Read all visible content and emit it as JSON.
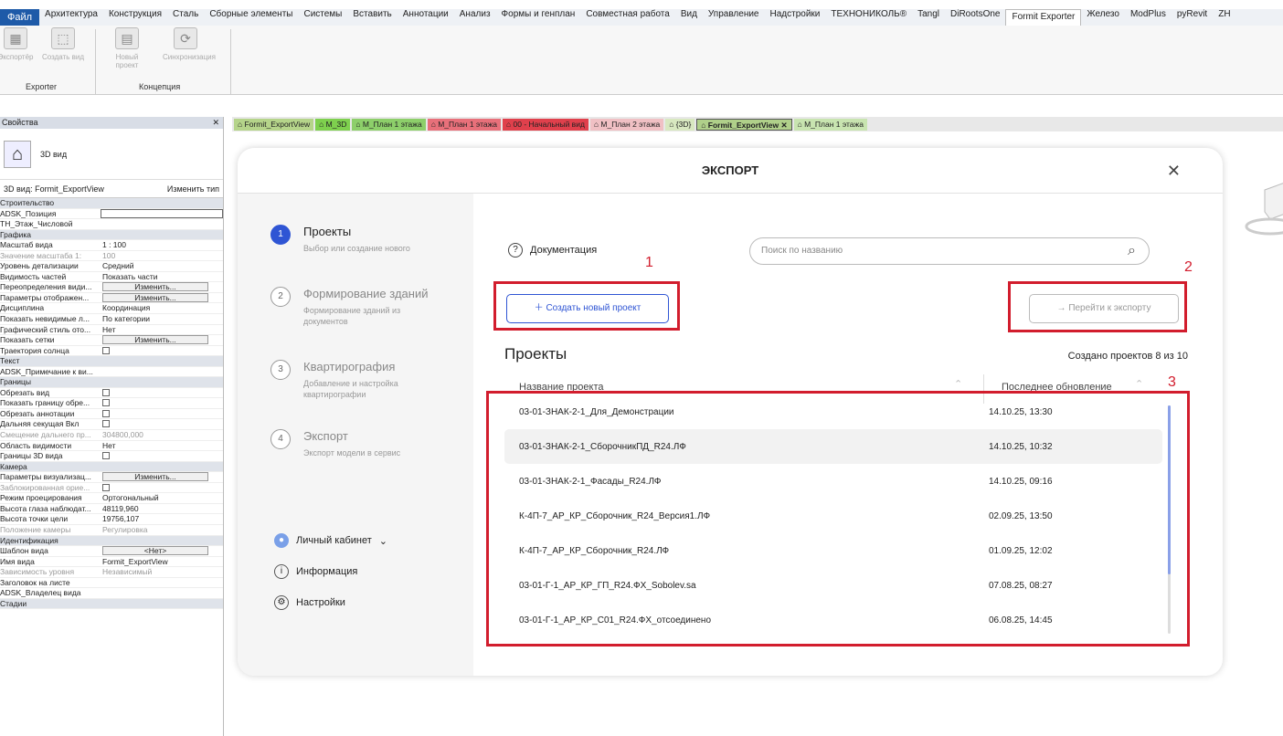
{
  "menu": {
    "file": "Файл",
    "items": [
      "Архитектура",
      "Конструкция",
      "Сталь",
      "Сборные элементы",
      "Системы",
      "Вставить",
      "Аннотации",
      "Анализ",
      "Формы и генплан",
      "Совместная работа",
      "Вид",
      "Управление",
      "Надстройки",
      "ТЕХНОНИКОЛЬ®",
      "Tangl",
      "DiRootsOne",
      "Formit Exporter",
      "Железо",
      "ModPlus",
      "pyRevit",
      "ZH"
    ],
    "active": "Formit Exporter"
  },
  "ribbon": {
    "buttons": [
      "Экспортёр",
      "Создать вид",
      "Новый проект",
      "Синхронизация"
    ],
    "panels": [
      "Exporter",
      "Концепция"
    ]
  },
  "props": {
    "title": "Свойства",
    "type": "3D вид",
    "view_label": "3D вид: Formit_ExportView",
    "edit_type": "Изменить тип",
    "rows": [
      {
        "g": "Строительство"
      },
      {
        "n": "ADSK_Позиция",
        "v": "",
        "input": true
      },
      {
        "n": "ТН_Этаж_Числовой",
        "v": ""
      },
      {
        "g": "Графика"
      },
      {
        "n": "Масштаб вида",
        "v": "1 : 100"
      },
      {
        "n": "Значение масштаба  1:",
        "v": "100",
        "dim": true
      },
      {
        "n": "Уровень детализации",
        "v": "Средний"
      },
      {
        "n": "Видимость частей",
        "v": "Показать части"
      },
      {
        "n": "Переопределения види...",
        "v": "Изменить...",
        "btn": true
      },
      {
        "n": "Параметры отображен...",
        "v": "Изменить...",
        "btn": true
      },
      {
        "n": "Дисциплина",
        "v": "Координация"
      },
      {
        "n": "Показать невидимые л...",
        "v": "По категории"
      },
      {
        "n": "Графический стиль ото...",
        "v": "Нет"
      },
      {
        "n": "Показать сетки",
        "v": "Изменить...",
        "btn": true
      },
      {
        "n": "Траектория солнца",
        "v": "",
        "cb": true
      },
      {
        "g": "Текст"
      },
      {
        "n": "ADSK_Примечание к ви...",
        "v": ""
      },
      {
        "g": "Границы"
      },
      {
        "n": "Обрезать вид",
        "v": "",
        "cb": true
      },
      {
        "n": "Показать границу обре...",
        "v": "",
        "cb": true
      },
      {
        "n": "Обрезать аннотации",
        "v": "",
        "cb": true
      },
      {
        "n": "Дальняя секущая Вкл",
        "v": "",
        "cb": true
      },
      {
        "n": "Смещение дальнего пр...",
        "v": "304800,000",
        "dim": true
      },
      {
        "n": "Область видимости",
        "v": "Нет"
      },
      {
        "n": "Границы 3D вида",
        "v": "",
        "cb": true
      },
      {
        "g": "Камера"
      },
      {
        "n": "Параметры визуализац...",
        "v": "Изменить...",
        "btn": true
      },
      {
        "n": "Заблокированная орие...",
        "v": "",
        "cb": true,
        "dim": true
      },
      {
        "n": "Режим проецирования",
        "v": "Ортогональный"
      },
      {
        "n": "Высота глаза наблюдат...",
        "v": "48119,960"
      },
      {
        "n": "Высота точки цели",
        "v": "19756,107"
      },
      {
        "n": "Положение камеры",
        "v": "Регулировка",
        "dim": true
      },
      {
        "g": "Идентификация"
      },
      {
        "n": "Шаблон вида",
        "v": "<Нет>",
        "btn": true
      },
      {
        "n": "Имя вида",
        "v": "Formit_ExportView"
      },
      {
        "n": "Зависимость уровня",
        "v": "Независимый",
        "dim": true
      },
      {
        "n": "Заголовок на листе",
        "v": ""
      },
      {
        "n": "ADSK_Владелец вида",
        "v": ""
      },
      {
        "g": "Стадии"
      }
    ]
  },
  "tabs": [
    {
      "label": "Formit_ExportView",
      "color": "#b5d48a"
    },
    {
      "label": "M_3D",
      "color": "#7ed04e"
    },
    {
      "label": "M_План 1 этажа",
      "color": "#8dcf6a"
    },
    {
      "label": "M_План 1 этажа",
      "color": "#e8707a"
    },
    {
      "label": "00 - Начальный вид",
      "color": "#e0404c"
    },
    {
      "label": "M_План 2 этажа",
      "color": "#f0c0c4"
    },
    {
      "label": "{3D}",
      "color": "#d8e8c0"
    },
    {
      "label": "Formit_ExportView",
      "color": "#b0d08a",
      "sel": true
    },
    {
      "label": "M_План 1 этажа",
      "color": "#c8e4b0"
    }
  ],
  "dialog": {
    "title": "ЭКСПОРТ",
    "close": "✕",
    "steps": [
      {
        "n": "1",
        "t": "Проекты",
        "s": "Выбор или создание нового",
        "on": true
      },
      {
        "n": "2",
        "t": "Формирование зданий",
        "s": "Формирование зданий из документов"
      },
      {
        "n": "3",
        "t": "Квартирография",
        "s": "Добавление и настройка квартирографии"
      },
      {
        "n": "4",
        "t": "Экспорт",
        "s": "Экспорт модели в сервис"
      }
    ],
    "side": {
      "account": "Личный кабинет",
      "info": "Информация",
      "settings": "Настройки"
    },
    "doc": "Документация",
    "search_placeholder": "Поиск по названию",
    "new_project": "Создать новый проект",
    "go_export": "Перейти к экспорту",
    "projects_title": "Проекты",
    "projects_count": "Создано проектов 8 из 10",
    "col_name": "Название проекта",
    "col_updated": "Последнее обновление",
    "projects": [
      {
        "name": "03-01-ЗНАК-2-1_Для_Демонстрации",
        "date": "14.10.25, 13:30"
      },
      {
        "name": "03-01-ЗНАК-2-1_СборочникПД_R24.ЛФ",
        "date": "14.10.25, 10:32"
      },
      {
        "name": "03-01-ЗНАК-2-1_Фасады_R24.ЛФ",
        "date": "14.10.25, 09:16"
      },
      {
        "name": "К-4П-7_АР_КР_Сборочник_R24_Версия1.ЛФ",
        "date": "02.09.25, 13:50"
      },
      {
        "name": "К-4П-7_АР_КР_Сборочник_R24.ЛФ",
        "date": "01.09.25, 12:02"
      },
      {
        "name": "03-01-Г-1_АР_КР_ГП_R24.ФХ_Sobolev.sa",
        "date": "07.08.25, 08:27"
      },
      {
        "name": "03-01-Г-1_АР_КР_С01_R24.ФХ_отсоединено",
        "date": "06.08.25, 14:45"
      }
    ]
  },
  "annotations": [
    "1",
    "2",
    "3"
  ]
}
